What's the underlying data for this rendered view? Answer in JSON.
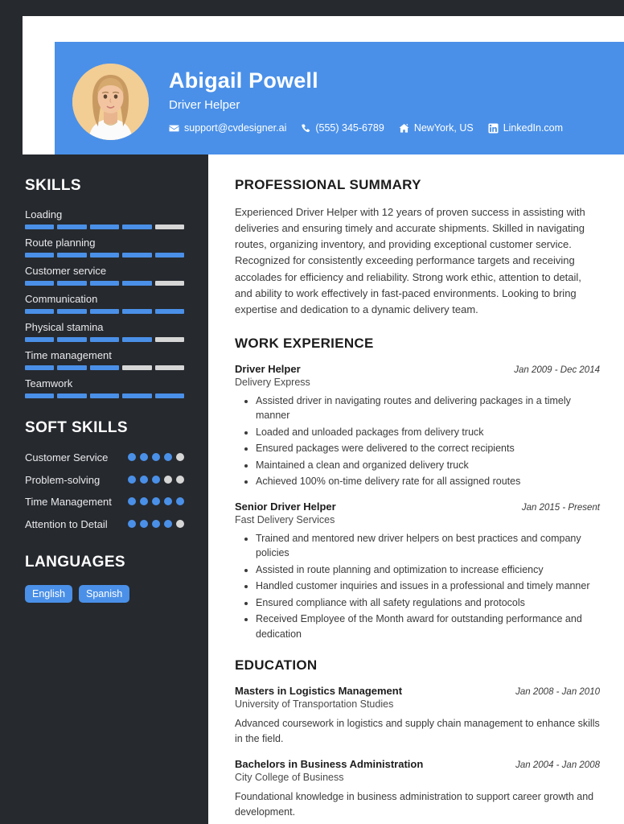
{
  "header": {
    "name": "Abigail Powell",
    "role": "Driver Helper",
    "contacts": [
      {
        "icon": "envelope-icon",
        "text": "support@cvdesigner.ai"
      },
      {
        "icon": "phone-icon",
        "text": "(555) 345-6789"
      },
      {
        "icon": "home-icon",
        "text": "NewYork, US"
      },
      {
        "icon": "linkedin-icon",
        "text": "LinkedIn.com"
      }
    ]
  },
  "sidebar": {
    "skills_heading": "SKILLS",
    "skills": [
      {
        "name": "Loading",
        "level": 4,
        "max": 5
      },
      {
        "name": "Route planning",
        "level": 5,
        "max": 5
      },
      {
        "name": "Customer service",
        "level": 4,
        "max": 5
      },
      {
        "name": "Communication",
        "level": 5,
        "max": 5
      },
      {
        "name": "Physical stamina",
        "level": 4,
        "max": 5
      },
      {
        "name": "Time management",
        "level": 3,
        "max": 5
      },
      {
        "name": "Teamwork",
        "level": 5,
        "max": 5
      }
    ],
    "soft_skills_heading": "SOFT SKILLS",
    "soft_skills": [
      {
        "name": "Customer Service",
        "level": 4,
        "max": 5
      },
      {
        "name": "Problem-solving",
        "level": 3,
        "max": 5
      },
      {
        "name": "Time Management",
        "level": 5,
        "max": 5
      },
      {
        "name": "Attention to Detail",
        "level": 4,
        "max": 5
      }
    ],
    "languages_heading": "LANGUAGES",
    "languages": [
      "English",
      "Spanish"
    ]
  },
  "main": {
    "summary_heading": "PROFESSIONAL SUMMARY",
    "summary_text": "Experienced Driver Helper with 12 years of proven success in assisting with deliveries and ensuring timely and accurate shipments. Skilled in navigating routes, organizing inventory, and providing exceptional customer service. Recognized for consistently exceeding performance targets and receiving accolades for efficiency and reliability. Strong work ethic, attention to detail, and ability to work effectively in fast-paced environments. Looking to bring expertise and dedication to a dynamic delivery team.",
    "experience_heading": "WORK EXPERIENCE",
    "experience": [
      {
        "title": "Driver Helper",
        "company": "Delivery Express",
        "date": "Jan 2009 - Dec 2014",
        "bullets": [
          "Assisted driver in navigating routes and delivering packages in a timely manner",
          "Loaded and unloaded packages from delivery truck",
          "Ensured packages were delivered to the correct recipients",
          "Maintained a clean and organized delivery truck",
          "Achieved 100% on-time delivery rate for all assigned routes"
        ]
      },
      {
        "title": "Senior Driver Helper",
        "company": "Fast Delivery Services",
        "date": "Jan 2015 - Present",
        "bullets": [
          "Trained and mentored new driver helpers on best practices and company policies",
          "Assisted in route planning and optimization to increase efficiency",
          "Handled customer inquiries and issues in a professional and timely manner",
          "Ensured compliance with all safety regulations and protocols",
          "Received Employee of the Month award for outstanding performance and dedication"
        ]
      }
    ],
    "education_heading": "EDUCATION",
    "education": [
      {
        "degree": "Masters in Logistics Management",
        "school": "University of Transportation Studies",
        "date": "Jan 2008 - Jan 2010",
        "description": "Advanced coursework in logistics and supply chain management to enhance skills in the field."
      },
      {
        "degree": "Bachelors in Business Administration",
        "school": "City College of Business",
        "date": "Jan 2004 - Jan 2008",
        "description": "Foundational knowledge in business administration to support career growth and development."
      }
    ]
  },
  "colors": {
    "accent_blue": "#4a90e8",
    "sidebar_dark": "#26292e",
    "empty_bar": "#d6d6d6"
  }
}
